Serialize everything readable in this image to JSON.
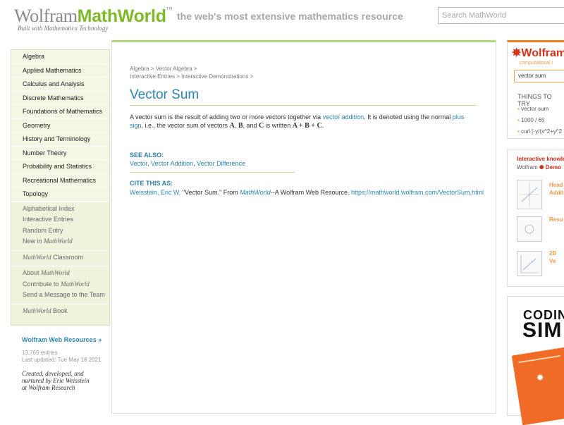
{
  "header": {
    "logo_wolfram": "Wolfram",
    "logo_mathworld": "MathWorld",
    "logo_tm": "™",
    "built_with": "Built with Mathematica Technology",
    "tagline": "the web's most extensive mathematics resource",
    "search_placeholder": "Search MathWorld"
  },
  "sidebar": {
    "topics": [
      "Algebra",
      "Applied Mathematics",
      "Calculus and Analysis",
      "Discrete Mathematics",
      "Foundations of Mathematics",
      "Geometry",
      "History and Terminology",
      "Number Theory",
      "Probability and Statistics",
      "Recreational Mathematics",
      "Topology"
    ],
    "links": [
      "Alphabetical Index",
      "Interactive Entries",
      "Random Entry"
    ],
    "new_in": "New in ",
    "mathworld": "MathWorld",
    "classroom": " Classroom",
    "about": "About ",
    "contribute": "Contribute to ",
    "send_message": "Send a Message to the Team",
    "book": " Book",
    "web_resources": "Wolfram Web Resources »",
    "entries": "13,769 entries",
    "updated": "Last updated: Tue May 18 2021",
    "credit": [
      "Created, developed, and",
      "nurtured by Eric Weisstein",
      "at Wolfram Research"
    ]
  },
  "main": {
    "breadcrumb": {
      "line1": [
        "Algebra",
        ">",
        "Vector Algebra",
        ">"
      ],
      "line2": [
        "Interactive Entries",
        ">",
        "Interactive Demonstrations",
        ">"
      ]
    },
    "title": "Vector Sum",
    "definition": {
      "t1": "A vector sum is the result of adding two or more vectors together via ",
      "link1": "vector addition",
      "t2": ". It is denoted using the normal ",
      "link2": "plus sign",
      "t3": ", i.e., the vector sum of vectors ",
      "a": "A",
      "comma": ", ",
      "b": "B",
      "and": ", and ",
      "c": "C",
      "written": " is written ",
      "sum": "A + B + C",
      "end": "."
    },
    "see_also_heading": "SEE ALSO:",
    "see_also": [
      "Vector",
      "Vector Addition",
      "Vector Difference"
    ],
    "cite_heading": "CITE THIS AS:",
    "cite": {
      "author": "Weisstein, Eric W.",
      "title": " \"Vector Sum.\" From ",
      "mathworld": "MathWorld",
      "resource": "--A Wolfram Web Resource. ",
      "url": "https://mathworld.wolfram.com/VectorSum.html"
    }
  },
  "right": {
    "wa_logo": "Wolfram",
    "wa_sub": "computational i",
    "wa_query": "vector sum",
    "things": "THINGS TO TRY",
    "tries": [
      "vector sum",
      "1000 / 65",
      "curl [-y/(x^2+y^2"
    ],
    "interactive": "Interactive knowle",
    "demos_prefix": "Wolfram ",
    "demos": "Demo",
    "thumbs": [
      "Head",
      "Addit",
      "Resu",
      "2D Ve"
    ],
    "coding": "CODING",
    "sim": "SIM"
  },
  "colors": {
    "accent": "#2a86b0",
    "green": "#7fba2a",
    "orange": "#f47c20"
  }
}
